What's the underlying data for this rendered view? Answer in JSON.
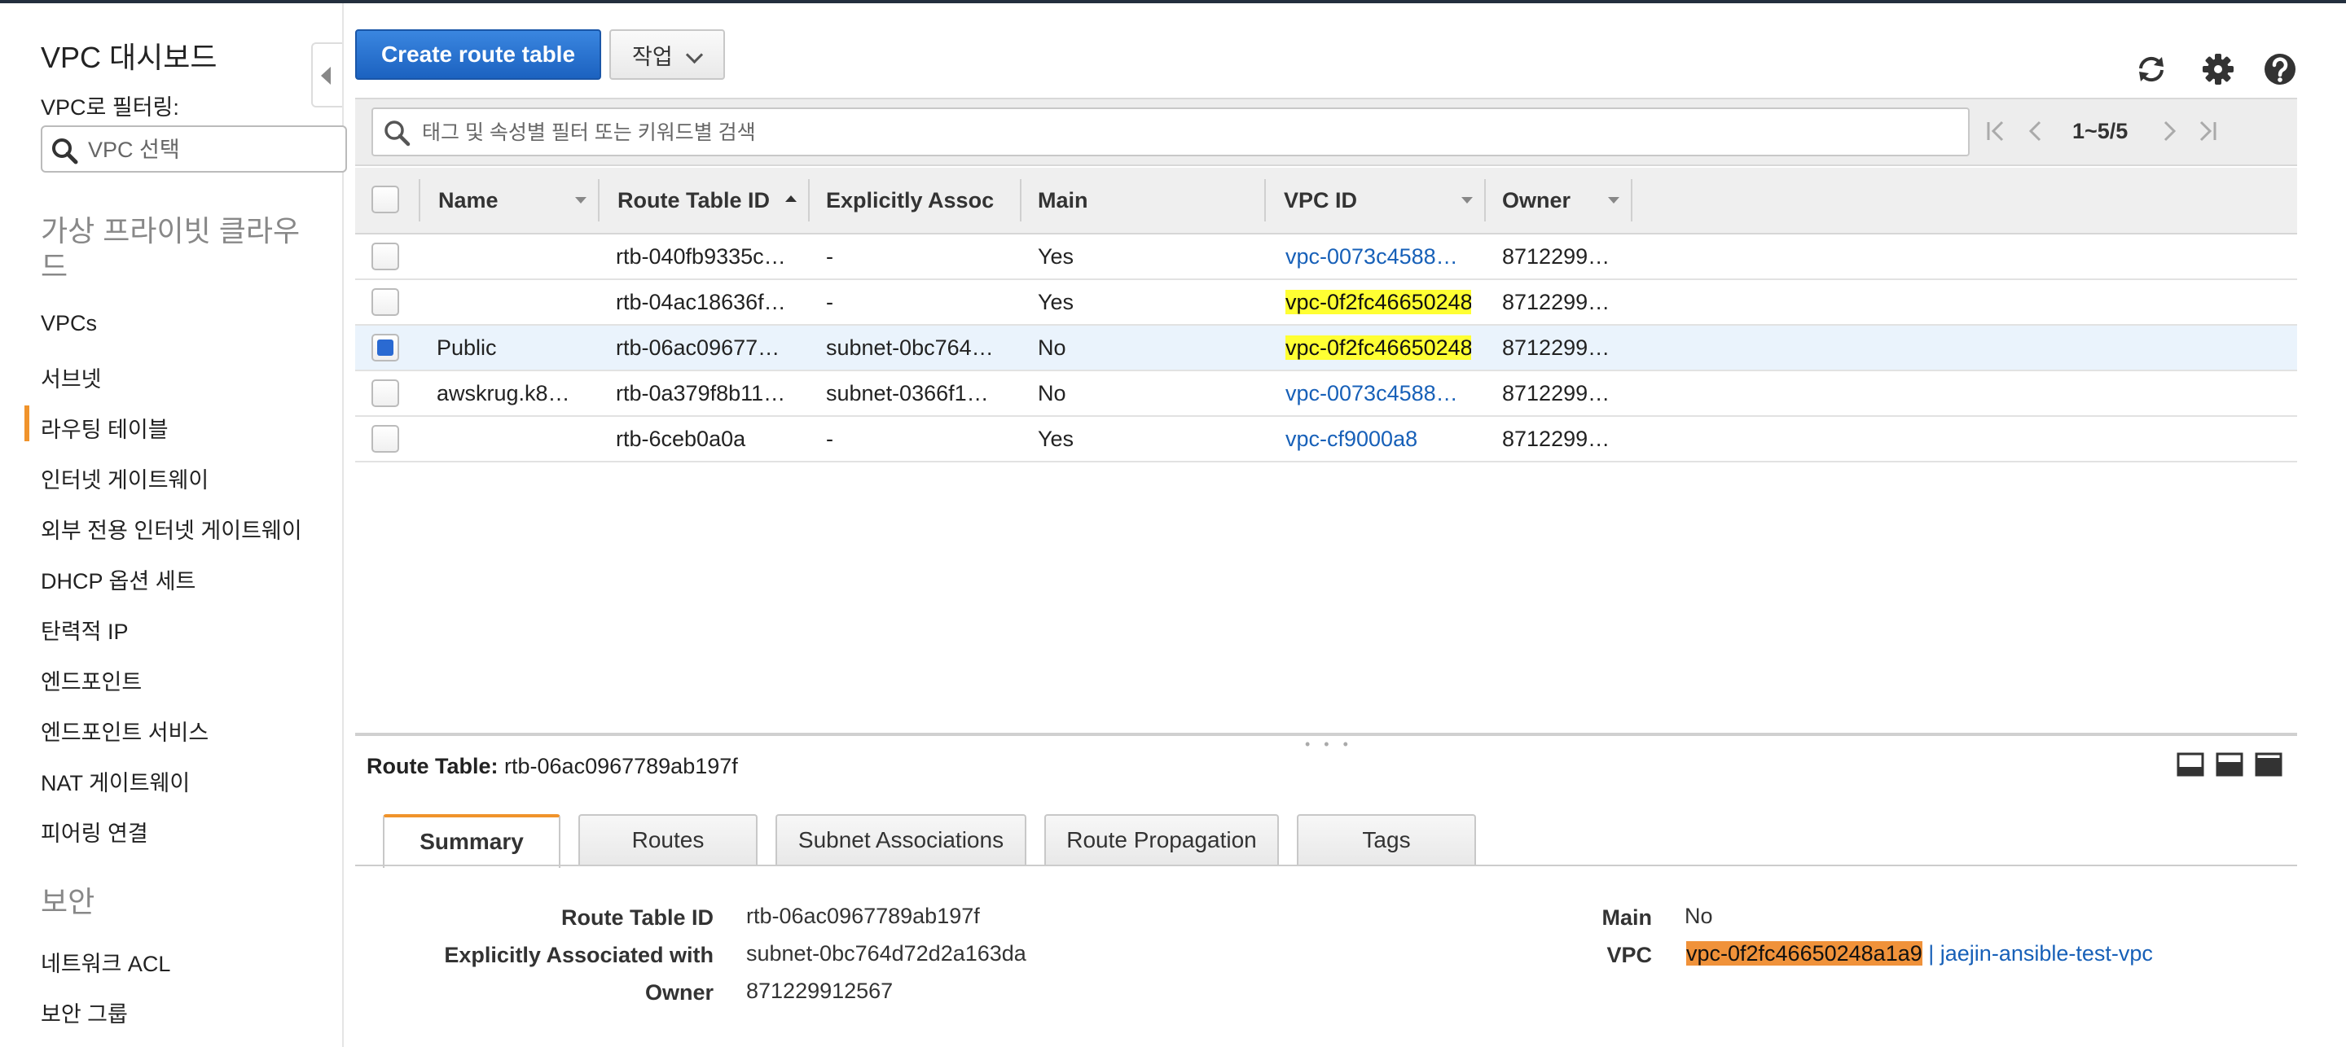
{
  "sidebar": {
    "title": "VPC 대시보드",
    "filter_label": "VPC로 필터링:",
    "vpc_placeholder": "VPC 선택",
    "section_vpc": "가상 프라이빗 클라우드",
    "items": [
      {
        "label": "VPCs"
      },
      {
        "label": "서브넷"
      },
      {
        "label": "라우팅 테이블"
      },
      {
        "label": "인터넷 게이트웨이"
      },
      {
        "label": "외부 전용 인터넷 게이트웨이"
      },
      {
        "label": "DHCP 옵션 세트"
      },
      {
        "label": "탄력적 IP"
      },
      {
        "label": "엔드포인트"
      },
      {
        "label": "엔드포인트 서비스"
      },
      {
        "label": "NAT 게이트웨이"
      },
      {
        "label": "피어링 연결"
      }
    ],
    "section_security": "보안",
    "security_items": [
      {
        "label": "네트워크 ACL"
      },
      {
        "label": "보안 그룹"
      }
    ]
  },
  "toolbar": {
    "create_label": "Create route table",
    "actions_label": "작업"
  },
  "icons": {
    "refresh": "refresh-icon",
    "settings": "gear-icon",
    "help": "help-icon"
  },
  "search": {
    "placeholder": "태그 및 속성별 필터 또는 키워드별 검색"
  },
  "pager": {
    "range": "1~5/5"
  },
  "table": {
    "headers": {
      "name": "Name",
      "route_table_id": "Route Table ID",
      "explicitly_assoc": "Explicitly Assoc",
      "main": "Main",
      "vpc_id": "VPC ID",
      "owner": "Owner"
    },
    "rows": [
      {
        "name": "",
        "route_table_id": "rtb-040fb9335c…",
        "assoc": "-",
        "main": "Yes",
        "vpc_id": "vpc-0073c4588…",
        "owner": "8712299…"
      },
      {
        "name": "",
        "route_table_id": "rtb-04ac18636f…",
        "assoc": "-",
        "main": "Yes",
        "vpc_id": "vpc-0f2fc46650248",
        "owner": "8712299…"
      },
      {
        "name": "Public",
        "route_table_id": "rtb-06ac09677…",
        "assoc": "subnet-0bc764…",
        "main": "No",
        "vpc_id": "vpc-0f2fc46650248",
        "owner": "8712299…"
      },
      {
        "name": "awskrug.k8…",
        "route_table_id": "rtb-0a379f8b11…",
        "assoc": "subnet-0366f1…",
        "main": "No",
        "vpc_id": "vpc-0073c4588…",
        "owner": "8712299…"
      },
      {
        "name": "",
        "route_table_id": "rtb-6ceb0a0a",
        "assoc": "-",
        "main": "Yes",
        "vpc_id": "vpc-cf9000a8",
        "owner": "8712299…"
      }
    ]
  },
  "detail": {
    "title_label": "Route Table:",
    "title_value": "rtb-06ac0967789ab197f",
    "tabs": [
      {
        "label": "Summary"
      },
      {
        "label": "Routes"
      },
      {
        "label": "Subnet Associations"
      },
      {
        "label": "Route Propagation"
      },
      {
        "label": "Tags"
      }
    ],
    "summary": {
      "route_table_id_label": "Route Table ID",
      "route_table_id": "rtb-06ac0967789ab197f",
      "assoc_label": "Explicitly Associated with",
      "assoc": "subnet-0bc764d72d2a163da",
      "owner_label": "Owner",
      "owner": "871229912567",
      "main_label": "Main",
      "main": "No",
      "vpc_label": "VPC",
      "vpc_id": "vpc-0f2fc46650248a1a9",
      "vpc_sep": " | ",
      "vpc_name": "jaejin-ansible-test-vpc"
    }
  },
  "colors": {
    "primary_button": "#1f6fd1",
    "accent_orange": "#f0932b",
    "link": "#1760b8",
    "highlight_yellow": "#ffff33",
    "highlight_orange": "#f0923a"
  }
}
